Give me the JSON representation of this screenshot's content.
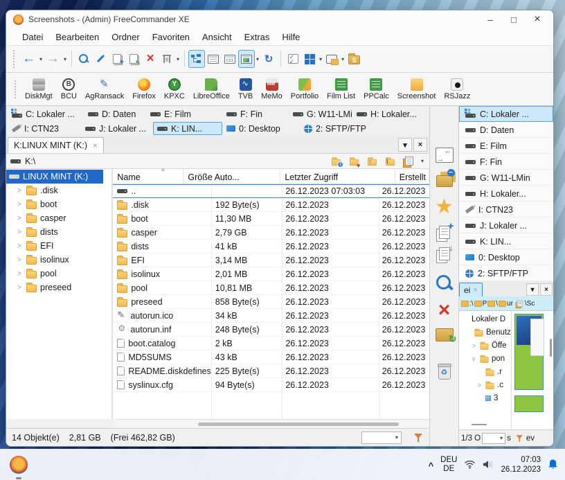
{
  "window": {
    "title": "Screenshots - (Admin) FreeCommander XE",
    "menu": [
      "Datei",
      "Bearbeiten",
      "Ordner",
      "Favoriten",
      "Ansicht",
      "Extras",
      "Hilfe"
    ],
    "controls": {
      "minimize": "–",
      "maximize": "□",
      "close": "×"
    },
    "launchers": [
      {
        "label": "DiskMgt",
        "icon_style": "li-diskmgt"
      },
      {
        "label": "BCU",
        "icon_style": "li-bcu",
        "glyph": "B"
      },
      {
        "label": "AgRansack",
        "icon_style": "li-agr"
      },
      {
        "label": "Firefox",
        "icon_style": "li-ffx"
      },
      {
        "label": "KPXC",
        "icon_style": "li-kpxc",
        "glyph": "Y"
      },
      {
        "label": "LibreOffice",
        "icon_style": "li-lo"
      },
      {
        "label": "TVB",
        "icon_style": "li-tvb"
      },
      {
        "label": "MeMo",
        "icon_style": "li-memo"
      },
      {
        "label": "Portfolio",
        "icon_style": "li-port"
      },
      {
        "label": "Film List",
        "icon_style": "li-sheet"
      },
      {
        "label": "PPCalc",
        "icon_style": "li-sheet"
      },
      {
        "label": "Screenshot",
        "icon_style": "li-shot"
      },
      {
        "label": "RSJazz",
        "icon_style": "li-rsj"
      }
    ],
    "drive_tabs_row1": [
      {
        "label": "C: Lokaler ...",
        "icon": "drive-win"
      },
      {
        "label": "D: Daten",
        "icon": "drive"
      },
      {
        "label": "E: Film",
        "icon": "drive"
      },
      {
        "label": "F: Fin",
        "icon": "drive"
      },
      {
        "label": "G: W11-LMin",
        "icon": "drive"
      },
      {
        "label": "H: Lokaler...",
        "icon": "drive"
      }
    ],
    "drive_tabs_row2": [
      {
        "label": "I: CTN23",
        "icon": "usb"
      },
      {
        "label": "J: Lokaler ...",
        "icon": "drive"
      },
      {
        "label": "K: LIN...",
        "icon": "drive",
        "active": true
      },
      {
        "label": "0: Desktop",
        "icon": "desktop"
      },
      {
        "label": "2: SFTP/FTP",
        "icon": "globe"
      }
    ],
    "folder_tab": {
      "label": "K:LINUX MINT (K:)",
      "close": "×"
    },
    "path": "K:\\",
    "tree": {
      "root": "LINUX MINT (K:)",
      "items": [
        ".disk",
        "boot",
        "casper",
        "dists",
        "EFI",
        "isolinux",
        "pool",
        "preseed"
      ]
    },
    "list": {
      "columns": [
        "Name",
        "Größe Auto...",
        "Letzter Zugriff",
        "Erstellt"
      ],
      "sort_indicator": "^",
      "rows": [
        {
          "name": "..",
          "icon": "drive",
          "size": "",
          "accessed": "26.12.2023 07:03:03",
          "created": "26.12.2023",
          "selected": true
        },
        {
          "name": ".disk",
          "icon": "folder",
          "size": "192 Byte(s)",
          "accessed": "26.12.2023",
          "created": "26.12.2023"
        },
        {
          "name": "boot",
          "icon": "folder",
          "size": "11,30 MB",
          "accessed": "26.12.2023",
          "created": "26.12.2023"
        },
        {
          "name": "casper",
          "icon": "folder",
          "size": "2,79 GB",
          "accessed": "26.12.2023",
          "created": "26.12.2023"
        },
        {
          "name": "dists",
          "icon": "folder",
          "size": "41 kB",
          "accessed": "26.12.2023",
          "created": "26.12.2023"
        },
        {
          "name": "EFI",
          "icon": "folder",
          "size": "3,14 MB",
          "accessed": "26.12.2023",
          "created": "26.12.2023"
        },
        {
          "name": "isolinux",
          "icon": "folder",
          "size": "2,01 MB",
          "accessed": "26.12.2023",
          "created": "26.12.2023"
        },
        {
          "name": "pool",
          "icon": "folder",
          "size": "10,81 MB",
          "accessed": "26.12.2023",
          "created": "26.12.2023"
        },
        {
          "name": "preseed",
          "icon": "folder",
          "size": "858 Byte(s)",
          "accessed": "26.12.2023",
          "created": "26.12.2023"
        },
        {
          "name": "autorun.ico",
          "icon": "pen",
          "size": "34 kB",
          "accessed": "26.12.2023",
          "created": "26.12.2023"
        },
        {
          "name": "autorun.inf",
          "icon": "gear",
          "size": "248 Byte(s)",
          "accessed": "26.12.2023",
          "created": "26.12.2023"
        },
        {
          "name": "boot.catalog",
          "icon": "file",
          "size": "2 kB",
          "accessed": "26.12.2023",
          "created": "26.12.2023"
        },
        {
          "name": "MD5SUMS",
          "icon": "file",
          "size": "43 kB",
          "accessed": "26.12.2023",
          "created": "26.12.2023"
        },
        {
          "name": "README.diskdefines",
          "icon": "file",
          "size": "225 Byte(s)",
          "accessed": "26.12.2023",
          "created": "26.12.2023"
        },
        {
          "name": "syslinux.cfg",
          "icon": "file",
          "size": "94 Byte(s)",
          "accessed": "26.12.2023",
          "created": "26.12.2023"
        }
      ]
    },
    "statusbar": {
      "objects": "14 Objekt(e)",
      "size": "2,81 GB",
      "free": "(Frei 462,82 GB)"
    }
  },
  "right_panel": {
    "drives": [
      {
        "label": "C: Lokaler ...",
        "icon": "drive-win",
        "active": true
      },
      {
        "label": "D: Daten",
        "icon": "drive"
      },
      {
        "label": "E: Film",
        "icon": "drive"
      },
      {
        "label": "F: Fin",
        "icon": "drive"
      },
      {
        "label": "G: W11-LMin",
        "icon": "drive"
      },
      {
        "label": "H: Lokaler...",
        "icon": "drive"
      },
      {
        "label": "I: CTN23",
        "icon": "usb"
      },
      {
        "label": "J: Lokaler ...",
        "icon": "drive"
      },
      {
        "label": "K: LIN...",
        "icon": "drive"
      },
      {
        "label": "0: Desktop",
        "icon": "desktop"
      },
      {
        "label": "2: SFTP/FTP",
        "icon": "globe"
      }
    ],
    "mini": {
      "tab": "ei",
      "tab_close": "×",
      "path_fragments": {
        "f1": ":\\",
        "f2": "P",
        "f3": "\\",
        "f4": "ur",
        "f5": "\\Sc"
      },
      "tree": [
        {
          "label": "Lokaler D",
          "icon": "none",
          "chev": "",
          "indent": 0
        },
        {
          "label": "Benutz",
          "icon": "folder",
          "chev": "",
          "indent": 1
        },
        {
          "label": "Öffe",
          "icon": "folder",
          "chev": ">",
          "indent": 2
        },
        {
          "label": "pon",
          "icon": "folder",
          "chev": "v",
          "indent": 2
        },
        {
          "label": ".r",
          "icon": "folder",
          "chev": "",
          "indent": 3
        },
        {
          "label": ".c",
          "icon": "folder",
          "chev": ">",
          "indent": 3
        },
        {
          "label": "3",
          "icon": "cube",
          "chev": "",
          "indent": 3
        }
      ],
      "status_left": "1/3 O",
      "status_s": "s",
      "status_ev": "ev"
    }
  },
  "taskbar": {
    "lang_line1": "DEU",
    "lang_line2": "DE",
    "time": "07:03",
    "date": "26.12.2023"
  }
}
